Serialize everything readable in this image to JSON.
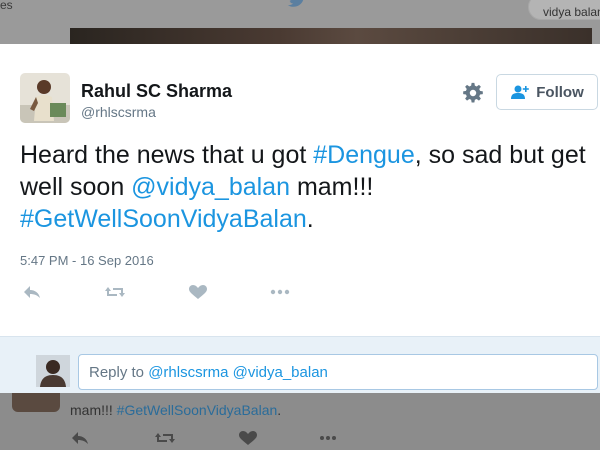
{
  "background": {
    "tab_fragment": "es",
    "search_text": "vidya balan",
    "tweet_text_plain": "mam!!! ",
    "tweet_text_tag": "#GetWellSoonVidyaBalan",
    "tweet_text_end": "."
  },
  "tweet": {
    "author_name": "Rahul SC Sharma",
    "author_handle": "@rhlscsrma",
    "follow_label": "Follow",
    "text_part1": "Heard the news that u got ",
    "hashtag1": "#Dengue",
    "text_part2": ", so sad but get well soon ",
    "mention": "@vidya_balan",
    "text_part3": " mam!!! ",
    "hashtag2": "#GetWellSoonVidyaBalan",
    "text_part4": ".",
    "timestamp": "5:47 PM - 16 Sep 2016"
  },
  "reply": {
    "prefix": "Reply to ",
    "mentions": "@rhlscsrma @vidya_balan"
  },
  "icons": [
    "twitter-bird-icon",
    "gear-icon",
    "follow-person-icon",
    "reply-icon",
    "retweet-icon",
    "like-icon",
    "more-icon"
  ],
  "colors": {
    "link": "#1b95e0",
    "text": "#14171a",
    "muted": "#657786",
    "reply_bg": "#e8f1f8"
  }
}
